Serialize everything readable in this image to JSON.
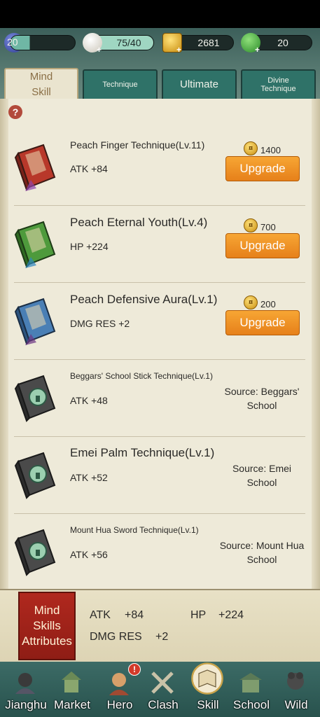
{
  "resources": {
    "level": "20",
    "stamina": "75/40",
    "gold": "2681",
    "jade": "20"
  },
  "tabs": [
    {
      "label": "Mind Skill"
    },
    {
      "label": "Technique"
    },
    {
      "label": "Ultimate"
    },
    {
      "label": "Divine Technique"
    }
  ],
  "skills": [
    {
      "name": "Peach Finger Technique(Lv.11)",
      "stat": "ATK +84",
      "cost": "1400",
      "action": "Upgrade",
      "book_color": "red"
    },
    {
      "name": "Peach Eternal Youth(Lv.4)",
      "stat": "HP +224",
      "cost": "700",
      "action": "Upgrade",
      "book_color": "green"
    },
    {
      "name": "Peach Defensive Aura(Lv.1)",
      "stat": "DMG RES +2",
      "cost": "200",
      "action": "Upgrade",
      "book_color": "blue"
    },
    {
      "name": "Beggars' School Stick Technique(Lv.1)",
      "stat": "ATK +48",
      "source": "Source: Beggars' School",
      "book_color": "locked"
    },
    {
      "name": "Emei Palm Technique(Lv.1)",
      "stat": "ATK +52",
      "source": "Source: Emei School",
      "book_color": "locked"
    },
    {
      "name": "Mount Hua Sword Technique(Lv.1)",
      "stat": "ATK +56",
      "source": "Source: Mount Hua School",
      "book_color": "locked"
    }
  ],
  "attributes": {
    "title": "Mind Skills Attributes",
    "atk_label": "ATK",
    "atk_value": "+84",
    "hp_label": "HP",
    "hp_value": "+224",
    "dmgres_label": "DMG RES",
    "dmgres_value": "+2"
  },
  "nav": [
    {
      "label": "Jianghu"
    },
    {
      "label": "Market"
    },
    {
      "label": "Hero",
      "alert": "!"
    },
    {
      "label": "Clash"
    },
    {
      "label": "Skill"
    },
    {
      "label": "School"
    },
    {
      "label": "Wild"
    }
  ],
  "colors": {
    "upgrade_button": "#f29a2e",
    "tab_inactive": "#2f7268",
    "panel_bg": "#eeead9",
    "badge_red": "#a82419"
  }
}
